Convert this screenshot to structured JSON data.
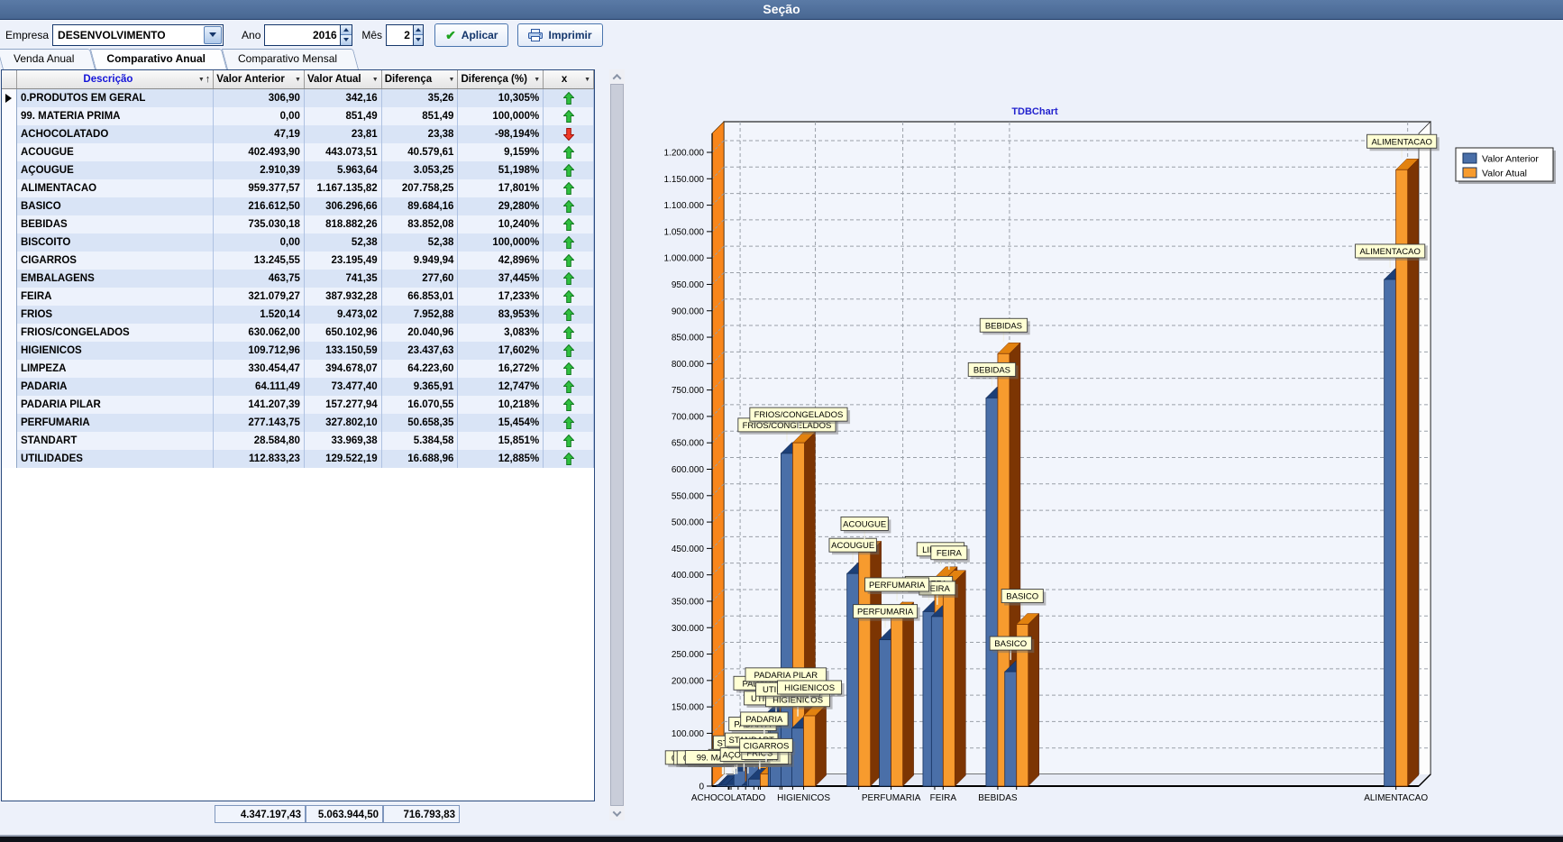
{
  "window": {
    "title": "Seção"
  },
  "toolbar": {
    "empresa_label": "Empresa",
    "empresa_value": "DESENVOLVIMENTO",
    "ano_label": "Ano",
    "ano_value": "2016",
    "mes_label": "Mês",
    "mes_value": "2",
    "aplicar_label": "Aplicar",
    "imprimir_label": "Imprimir"
  },
  "tabs": [
    {
      "label": "Venda Anual",
      "active": false
    },
    {
      "label": "Comparativo Anual",
      "active": true
    },
    {
      "label": "Comparativo Mensal",
      "active": false
    }
  ],
  "grid": {
    "columns": [
      "",
      "Descrição",
      "Valor Anterior",
      "Valor Atual",
      "Diferença",
      "Diferença (%)",
      "x"
    ],
    "rows": [
      [
        "0.PRODUTOS EM GERAL",
        "306,90",
        "342,16",
        "35,26",
        "10,305%",
        "up"
      ],
      [
        "99. MATERIA PRIMA",
        "0,00",
        "851,49",
        "851,49",
        "100,000%",
        "up"
      ],
      [
        "ACHOCOLATADO",
        "47,19",
        "23,81",
        "23,38",
        "-98,194%",
        "down"
      ],
      [
        "ACOUGUE",
        "402.493,90",
        "443.073,51",
        "40.579,61",
        "9,159%",
        "up"
      ],
      [
        "AÇOUGUE",
        "2.910,39",
        "5.963,64",
        "3.053,25",
        "51,198%",
        "up"
      ],
      [
        "ALIMENTACAO",
        "959.377,57",
        "1.167.135,82",
        "207.758,25",
        "17,801%",
        "up"
      ],
      [
        "BASICO",
        "216.612,50",
        "306.296,66",
        "89.684,16",
        "29,280%",
        "up"
      ],
      [
        "BEBIDAS",
        "735.030,18",
        "818.882,26",
        "83.852,08",
        "10,240%",
        "up"
      ],
      [
        "BISCOITO",
        "0,00",
        "52,38",
        "52,38",
        "100,000%",
        "up"
      ],
      [
        "CIGARROS",
        "13.245,55",
        "23.195,49",
        "9.949,94",
        "42,896%",
        "up"
      ],
      [
        "EMBALAGENS",
        "463,75",
        "741,35",
        "277,60",
        "37,445%",
        "up"
      ],
      [
        "FEIRA",
        "321.079,27",
        "387.932,28",
        "66.853,01",
        "17,233%",
        "up"
      ],
      [
        "FRIOS",
        "1.520,14",
        "9.473,02",
        "7.952,88",
        "83,953%",
        "up"
      ],
      [
        "FRIOS/CONGELADOS",
        "630.062,00",
        "650.102,96",
        "20.040,96",
        "3,083%",
        "up"
      ],
      [
        "HIGIENICOS",
        "109.712,96",
        "133.150,59",
        "23.437,63",
        "17,602%",
        "up"
      ],
      [
        "LIMPEZA",
        "330.454,47",
        "394.678,07",
        "64.223,60",
        "16,272%",
        "up"
      ],
      [
        "PADARIA",
        "64.111,49",
        "73.477,40",
        "9.365,91",
        "12,747%",
        "up"
      ],
      [
        "PADARIA PILAR",
        "141.207,39",
        "157.277,94",
        "16.070,55",
        "10,218%",
        "up"
      ],
      [
        "PERFUMARIA",
        "277.143,75",
        "327.802,10",
        "50.658,35",
        "15,454%",
        "up"
      ],
      [
        "STANDART",
        "28.584,80",
        "33.969,38",
        "5.384,58",
        "15,851%",
        "up"
      ],
      [
        "UTILIDADES",
        "112.833,23",
        "129.522,19",
        "16.688,96",
        "12,885%",
        "up"
      ]
    ],
    "totals": [
      "4.347.197,43",
      "5.063.944,50",
      "716.793,83"
    ],
    "status_colors": {
      "up": "#2FBF3F",
      "down": "#F03A28"
    }
  },
  "chart_data": {
    "type": "bar",
    "title": "TDBChart",
    "title_color": "#2323CE",
    "legend_position": "top-right",
    "legend": [
      {
        "name": "Valor Anterior",
        "color": "#4A6FA8"
      },
      {
        "name": "Valor Atual",
        "color": "#F79B2E"
      }
    ],
    "ylim": [
      0,
      1200000
    ],
    "ytick_step": 50000,
    "x_axis_is_value": "Diferença",
    "x_max": 217000,
    "x_tick_labels": [
      "ACHOCOLATADO",
      "HIGIENICOS",
      "PERFUMARIA",
      "FEIRA",
      "BEBIDAS",
      "ALIMENTACAO"
    ],
    "grid_dashed": true,
    "points": [
      {
        "name": "0.PRODUTOS EM GERAL",
        "valor_anterior": 306.9,
        "valor_atual": 342.16,
        "diferenca": 35.26
      },
      {
        "name": "99. MATERIA PRIMA",
        "valor_anterior": 0.0,
        "valor_atual": 851.49,
        "diferenca": 851.49
      },
      {
        "name": "ACHOCOLATADO",
        "valor_anterior": 47.19,
        "valor_atual": 23.81,
        "diferenca": 23.38
      },
      {
        "name": "ACOUGUE",
        "valor_anterior": 402493.9,
        "valor_atual": 443073.51,
        "diferenca": 40579.61
      },
      {
        "name": "AÇOUGUE",
        "valor_anterior": 2910.39,
        "valor_atual": 5963.64,
        "diferenca": 3053.25
      },
      {
        "name": "ALIMENTACAO",
        "valor_anterior": 959377.57,
        "valor_atual": 1167135.82,
        "diferenca": 207758.25
      },
      {
        "name": "BASICO",
        "valor_anterior": 216612.5,
        "valor_atual": 306296.66,
        "diferenca": 89684.16
      },
      {
        "name": "BEBIDAS",
        "valor_anterior": 735030.18,
        "valor_atual": 818882.26,
        "diferenca": 83852.08
      },
      {
        "name": "BISCOITO",
        "valor_anterior": 0.0,
        "valor_atual": 52.38,
        "diferenca": 52.38
      },
      {
        "name": "CIGARROS",
        "valor_anterior": 13245.55,
        "valor_atual": 23195.49,
        "diferenca": 9949.94
      },
      {
        "name": "EMBALAGENS",
        "valor_anterior": 463.75,
        "valor_atual": 741.35,
        "diferenca": 277.6
      },
      {
        "name": "FEIRA",
        "valor_anterior": 321079.27,
        "valor_atual": 387932.28,
        "diferenca": 66853.01
      },
      {
        "name": "FRIOS",
        "valor_anterior": 1520.14,
        "valor_atual": 9473.02,
        "diferenca": 7952.88
      },
      {
        "name": "FRIOS/CONGELADOS",
        "valor_anterior": 630062.0,
        "valor_atual": 650102.96,
        "diferenca": 20040.96
      },
      {
        "name": "HIGIENICOS",
        "valor_anterior": 109712.96,
        "valor_atual": 133150.59,
        "diferenca": 23437.63
      },
      {
        "name": "LIMPEZA",
        "valor_anterior": 330454.47,
        "valor_atual": 394678.07,
        "diferenca": 64223.6
      },
      {
        "name": "PADARIA",
        "valor_anterior": 64111.49,
        "valor_atual": 73477.4,
        "diferenca": 9365.91
      },
      {
        "name": "PADARIA PILAR",
        "valor_anterior": 141207.39,
        "valor_atual": 157277.94,
        "diferenca": 16070.55
      },
      {
        "name": "PERFUMARIA",
        "valor_anterior": 277143.75,
        "valor_atual": 327802.1,
        "diferenca": 50658.35
      },
      {
        "name": "STANDART",
        "valor_anterior": 28584.8,
        "valor_atual": 33969.38,
        "diferenca": 5384.58
      },
      {
        "name": "UTILIDADES",
        "valor_anterior": 112833.23,
        "valor_atual": 129522.19,
        "diferenca": 16688.96
      }
    ]
  }
}
